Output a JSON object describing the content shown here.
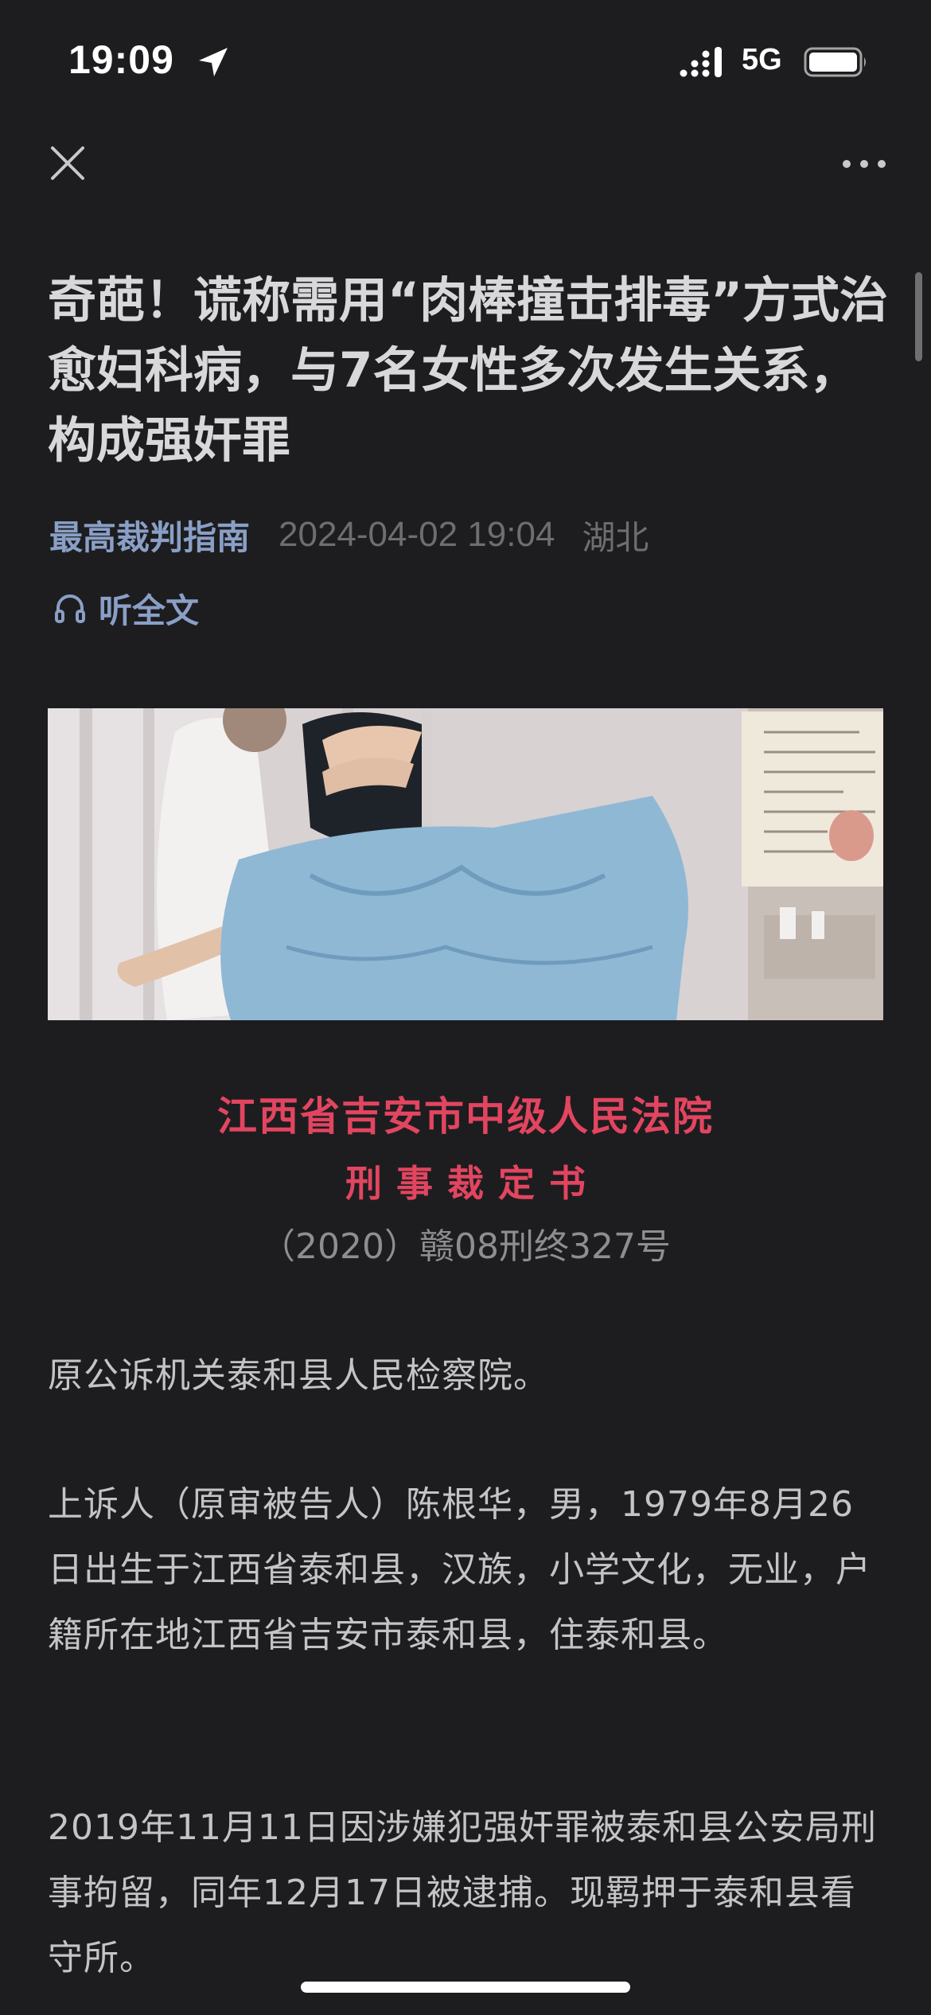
{
  "status_bar": {
    "time": "19:09",
    "network": "5G",
    "icons": [
      "location-arrow-icon",
      "signal-icon",
      "battery-icon"
    ]
  },
  "nav": {
    "close_icon": "close-icon",
    "more_icon": "more-icon"
  },
  "article": {
    "title": "奇葩！谎称需用“肉棒撞击排毒”方式治愈妇科病，与7名女性多次发生关系，构成强奸罪",
    "source": "最高裁判指南",
    "datetime": "2024-04-02 19:04",
    "location": "湖北",
    "listen_label": "听全文"
  },
  "document": {
    "court_name": "江西省吉安市中级人民法院",
    "doc_type": "刑事裁定书",
    "case_number": "（2020）赣08刑终327号"
  },
  "paragraphs": [
    "原公诉机关泰和县人民检察院。",
    "上诉人（原审被告人）陈根华，男，1979年8月26日出生于江西省泰和县，汉族，小学文化，无业，户籍所在地江西省吉安市泰和县，住泰和县。",
    "2019年11月11日因涉嫌犯强奸罪被泰和县公安局刑事拘留，同年12月17日被逮捕。现羁押于泰和县看守所。"
  ],
  "colors": {
    "background": "#1d1d1f",
    "accent_link": "#8a9fc6",
    "court_red": "#e24560",
    "muted_text": "#6e6e72"
  }
}
